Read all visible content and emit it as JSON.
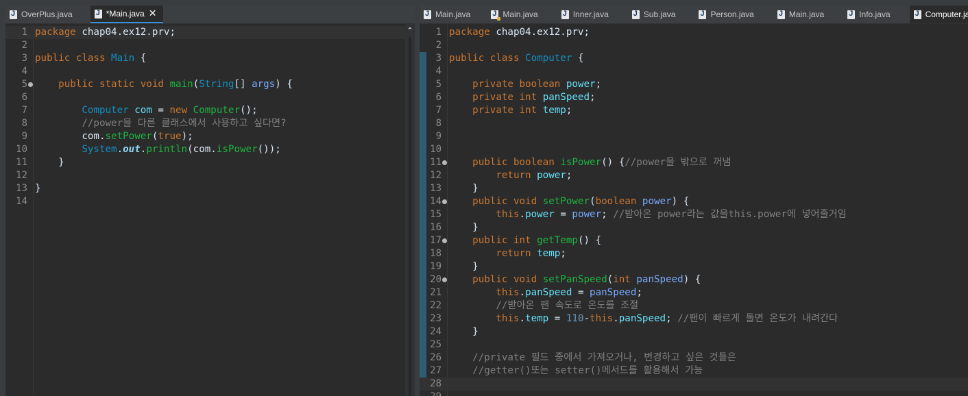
{
  "left": {
    "tabs": [
      {
        "label": "OverPlus.java"
      },
      {
        "label": "*Main.java"
      }
    ],
    "lines": [
      "<span class=\"kw\">package</span> chap04.ex12.prv;",
      "",
      "<span class=\"kw\">public class</span> <span class=\"ty\">Main</span> {",
      "",
      "    <span class=\"kw\">public static void</span> <span class=\"mt\">main</span>(<span class=\"ty\">String</span>[] <span class=\"pa\">args</span>) {",
      "",
      "        <span class=\"ty\">Computer</span> <span class=\"va\">com</span> = <span class=\"kw\">new</span> <span class=\"mt\">Computer</span>();",
      "        <span class=\"cm\">//power을 다른 클래스에서 사용하고 싶다면?</span>",
      "        com.<span class=\"mt\">setPower</span>(<span class=\"kw\">true</span>);",
      "        <span class=\"ty\">System</span>.<span class=\"st\">out</span>.<span class=\"mt\">println</span>(com.<span class=\"mt\">isPower</span>());",
      "    }",
      "",
      "}",
      ""
    ],
    "folds": [
      5
    ]
  },
  "right": {
    "tabs": [
      {
        "label": "Main.java"
      },
      {
        "label": "Main.java"
      },
      {
        "label": "Inner.java"
      },
      {
        "label": "Sub.java"
      },
      {
        "label": "Person.java"
      },
      {
        "label": "Main.java"
      },
      {
        "label": "Info.java"
      },
      {
        "label": "Computer.java"
      }
    ],
    "lines": [
      "<span class=\"kw\">package</span> chap04.ex12.prv;",
      "",
      "<span class=\"kw\">public class</span> <span class=\"ty\">Computer</span> {",
      "",
      "    <span class=\"kw\">private boolean</span> <span class=\"fd\">power</span>;",
      "    <span class=\"kw\">private int</span> <span class=\"fd\">panSpeed</span>;",
      "    <span class=\"kw\">private int</span> <span class=\"fd\">temp</span>;",
      "",
      "",
      "",
      "    <span class=\"kw\">public boolean</span> <span class=\"mt\">isPower</span>() {<span class=\"cm\">//power을 밖으로 꺼냄</span>",
      "        <span class=\"kw\">return</span> <span class=\"fd\">power</span>;",
      "    }",
      "    <span class=\"kw\">public void</span> <span class=\"mt\">setPower</span>(<span class=\"kw\">boolean</span> <span class=\"pa\">power</span>) {",
      "        <span class=\"kw\">this</span>.<span class=\"fd\">power</span> = <span class=\"pa\">power</span>; <span class=\"cm\">//받아온 power라는 값을this.power에 넣어줄거임</span>",
      "    }",
      "    <span class=\"kw\">public int</span> <span class=\"mt\">getTemp</span>() {",
      "        <span class=\"kw\">return</span> <span class=\"fd\">temp</span>;",
      "    }",
      "    <span class=\"kw\">public void</span> <span class=\"mt\">setPanSpeed</span>(<span class=\"kw\">int</span> <span class=\"pa\">panSpeed</span>) {",
      "        <span class=\"kw\">this</span>.<span class=\"fd\">panSpeed</span> = <span class=\"pa\">panSpeed</span>;",
      "        <span class=\"cm\">//받아온 팬 속도로 온도를 조절</span>",
      "        <span class=\"kw\">this</span>.<span class=\"fd\">temp</span> = <span class=\"nu\">110</span>-<span class=\"kw\">this</span>.<span class=\"fd\">panSpeed</span>; <span class=\"cm\">//팬이 빠르게 돌면 온도가 내려간다</span>",
      "    }",
      "",
      "    <span class=\"cm\">//private 필드 중에서 가져오거나, 변경하고 싶은 것들은</span>",
      "    <span class=\"cm\">//getter()또는 setter()메서드를 활용해서 가능</span>",
      "",
      ""
    ],
    "folds": [
      11,
      14,
      17,
      20
    ]
  },
  "colors": {
    "background": "#2b2b2b",
    "keyword": "#cc7832",
    "type": "#1290c3",
    "method": "#1eb540",
    "comment": "#808080"
  }
}
